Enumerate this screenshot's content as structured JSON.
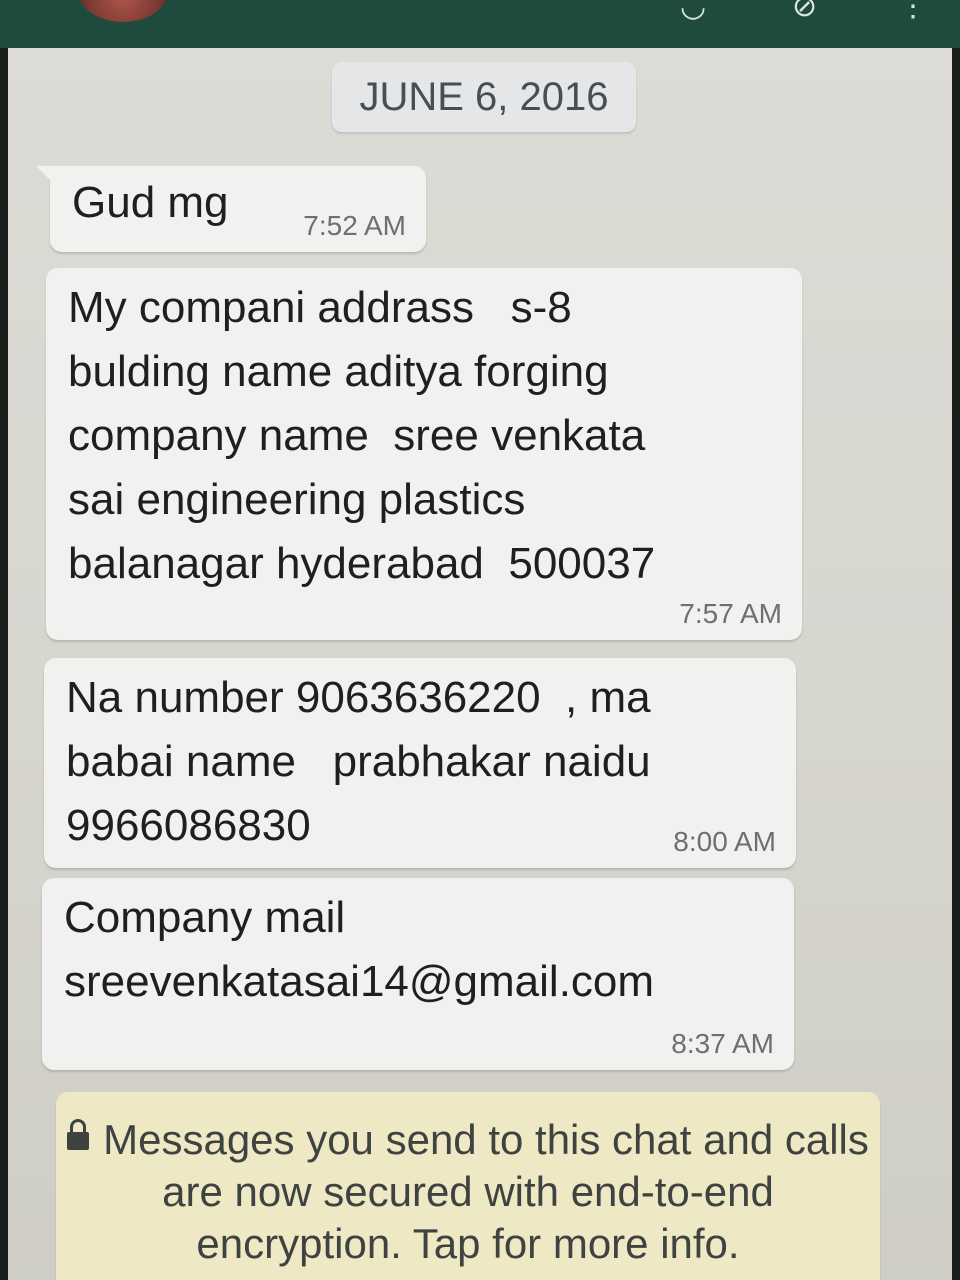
{
  "header": {
    "icons": [
      "avatar",
      "call-icon",
      "attach-icon",
      "menu-icon"
    ]
  },
  "chat": {
    "date": "JUNE 6, 2016",
    "messages": [
      {
        "text": "Gud mg",
        "time": "7:52 AM"
      },
      {
        "text": "My compani addrass   s-8\nbulding name aditya forging\ncompany name  sree venkata\nsai engineering plastics\nbalanagar hyderabad  500037",
        "time": "7:57 AM"
      },
      {
        "text": "Na number 9063636220  , ma\nbabai name   prabhakar naidu\n9966086830",
        "time": "8:00 AM"
      },
      {
        "text": "Company mail\nsreevenkatasai14@gmail.com",
        "time": "8:37 AM"
      }
    ],
    "encryption_notice": "Messages you send to this chat and calls are now secured with end-to-end encryption. Tap for more info."
  },
  "colors": {
    "header": "#1f4a3e",
    "chat_background": "#d8d7d0",
    "incoming_bubble": "#f1f1ef",
    "notice_background": "#eee8c5"
  }
}
